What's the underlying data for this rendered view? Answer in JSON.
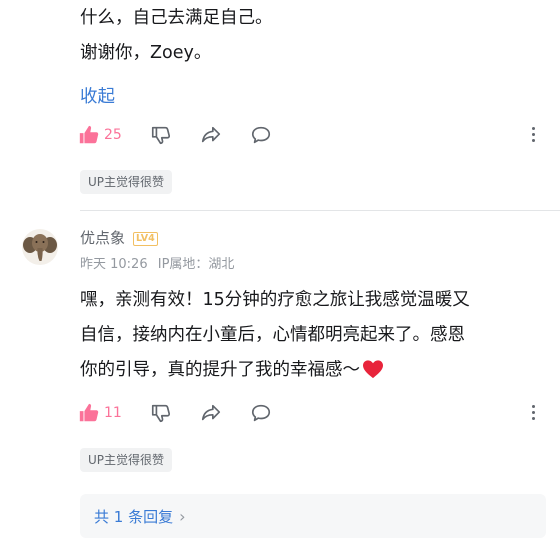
{
  "comment1": {
    "lines": [
      "什么，自己去满足自己。",
      "谢谢你，Zoey。"
    ],
    "collapse_label": "收起",
    "like_count": "25",
    "up_tag": "UP主觉得很赞"
  },
  "comment2": {
    "username": "优点象",
    "level_badge": "LV4",
    "time": "昨天 10:26",
    "ip": "IP属地：湖北",
    "lines": [
      "嘿，亲测有效！15分钟的疗愈之旅让我感觉温暖又",
      "自信，接纳内在小童后，心情都明亮起来了。感恩",
      "你的引导，真的提升了我的幸福感～"
    ],
    "heart_emoji": "❤️",
    "like_count": "11",
    "up_tag": "UP主觉得很赞",
    "reply_summary": "共 1 条回复",
    "reply_chevron": "›"
  },
  "colors": {
    "accent": "#fb7299",
    "link": "#3a7bd5",
    "muted": "#9499a0"
  },
  "icons": [
    "thumb-up-icon",
    "thumb-down-icon",
    "share-icon",
    "comment-icon",
    "more-icon",
    "heart-emoji"
  ]
}
